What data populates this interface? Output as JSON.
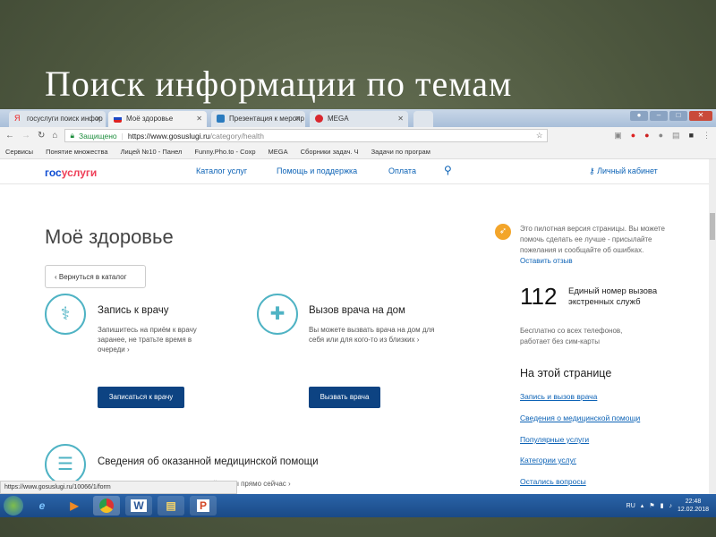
{
  "slide": {
    "title": "Поиск информации по темам"
  },
  "browser": {
    "tabs": [
      {
        "label": "госуслуги поиск инфор",
        "active": false
      },
      {
        "label": "Моё здоровье",
        "active": true
      },
      {
        "label": "Презентация к меропр",
        "active": false
      },
      {
        "label": "MEGA",
        "active": false
      }
    ],
    "security": "Защищено",
    "url_host": "https://www.gosuslugi.ru",
    "url_path": "/category/health",
    "bookmarks": [
      "Сервисы",
      "Понятие множества",
      "Лицей №10 - Панел",
      "Funny.Pho.to - Сохр",
      "MEGA",
      "Сборники задач. Ч",
      "Задачи по програм"
    ],
    "status_url": "https://www.gosuslugi.ru/10066/1/form"
  },
  "site": {
    "logo_a": "гос",
    "logo_b": "услуги",
    "nav": [
      "Каталог услуг",
      "Помощь и поддержка",
      "Оплата"
    ],
    "account": "Личный кабинет",
    "page_title": "Моё здоровье",
    "back": "Вернуться в каталог",
    "cards": [
      {
        "title": "Запись к врачу",
        "desc": "Запишитесь на приём к врачу заранее, не тратьте время в очереди",
        "button": "Записаться к врачу"
      },
      {
        "title": "Вызов врача на дом",
        "desc": "Вы можете вызвать врача на дом для себя или для кого-то из близких",
        "button": "Вызвать врача"
      },
      {
        "title": "Сведения об оказанной медицинской помощи",
        "desc": "Получите сведения из медицинской карты прямо сейчас"
      }
    ],
    "pilot": "Это пилотная версия страницы. Вы можете помочь сделать ее лучше - присылайте пожелания и сообщайте об ошибках.",
    "feedback": "Оставить отзыв",
    "emergency_number": "112",
    "emergency_label": "Единый номер вызова экстренных служб",
    "emergency_desc": "Бесплатно со всех телефонов, работает без сим-карты",
    "toc_title": "На этой странице",
    "toc": [
      "Запись и вызов врача",
      "Сведения о медицинской помощи",
      "Популярные услуги",
      "Категории услуг",
      "Остались вопросы"
    ]
  },
  "taskbar": {
    "lang": "RU",
    "time": "22:48",
    "date": "12.02.2018"
  }
}
